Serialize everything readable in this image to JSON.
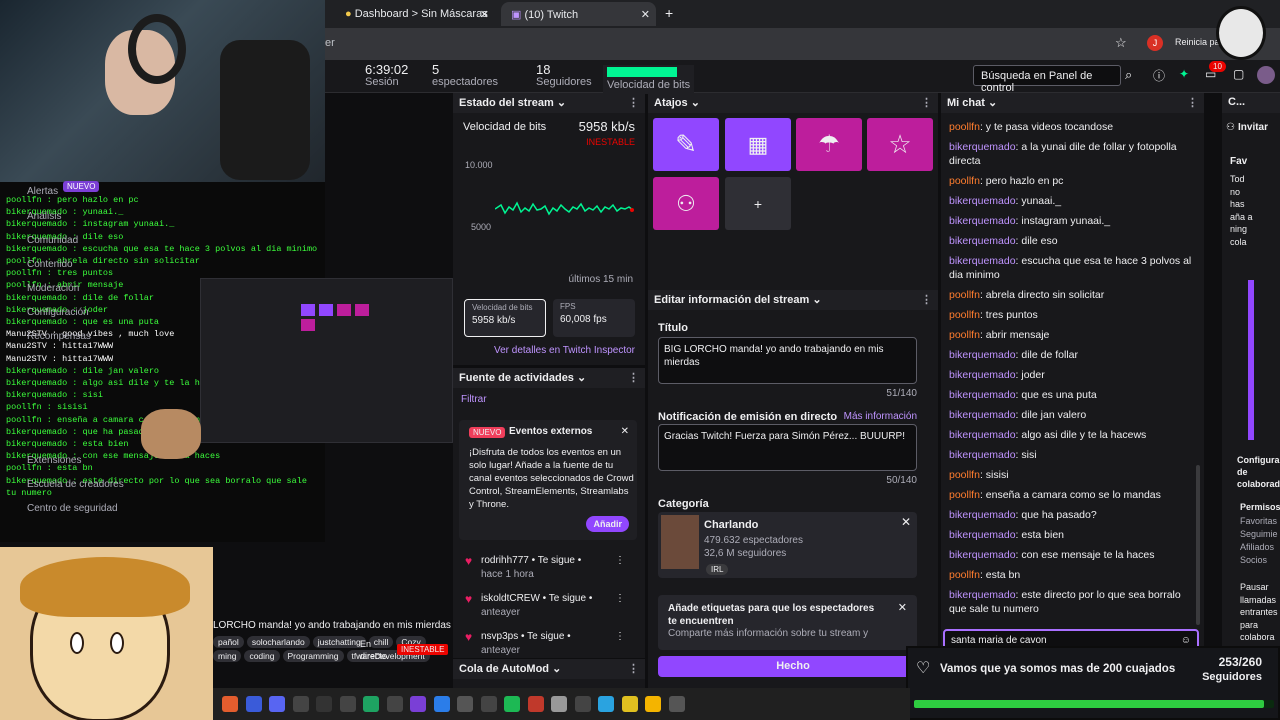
{
  "browser": {
    "tabs": [
      {
        "label": "Dashboard > Sin Máscaras"
      },
      {
        "label": "(10) Twitch"
      }
    ],
    "address_fragment": "er",
    "avatar_letter": "J",
    "restart_label": "Reinicia pa"
  },
  "topbar": {
    "uptime_value": "6:39:02",
    "uptime_label": "Sesión",
    "viewers_value": "5",
    "viewers_label": "espectadores",
    "followers_value": "18",
    "followers_label": "Seguidores",
    "bitrate_label": "Velocidad de bits",
    "search_label": "Búsqueda en Panel de control",
    "notif_count": "10"
  },
  "stream_state": {
    "title": "Estado del stream",
    "bitrate_label": "Velocidad de bits",
    "bitrate_value": "5958 kb/s",
    "status": "INESTABLE",
    "y_top": "10.000",
    "y_mid": "5000",
    "range_label": "últimos 15 min",
    "card1_label": "Velocidad de bits",
    "card1_value": "5958 kb/s",
    "card2_label": "FPS",
    "card2_value": "60,008 fps",
    "inspector_link": "Ver detalles en Twitch Inspector"
  },
  "activity": {
    "title": "Fuente de actividades",
    "filter": "Filtrar",
    "badge": "NUEVO",
    "ext_title": "Eventos externos",
    "ext_body": "¡Disfruta de todos los eventos en un solo lugar! Añade a la fuente de tu canal eventos seleccionados de Crowd Control, StreamElements, Streamlabs y Throne.",
    "add_button": "Añadir",
    "events": [
      {
        "user": "rodrihh777",
        "action": "Te sigue",
        "time": "hace 1 hora"
      },
      {
        "user": "iskoldtCREW",
        "action": "Te sigue",
        "time": "anteayer"
      },
      {
        "user": "nsvp3ps",
        "action": "Te sigue",
        "time": "anteayer"
      }
    ],
    "automod": "Cola de AutoMod"
  },
  "shortcuts": {
    "title": "Atajos",
    "add": "+"
  },
  "edit_info": {
    "title": "Editar información del stream",
    "title_label": "Título",
    "title_value": "BIG LORCHO manda! yo ando trabajando en mis mierdas",
    "title_count": "51/140",
    "notif_label": "Notificación de emisión en directo",
    "more_info": "Más información",
    "notif_value": "Gracias Twitch! Fuerza para Simón Pérez... BUUURP!",
    "notif_count": "50/140",
    "category_label": "Categoría",
    "category_name": "Charlando",
    "category_viewers": "479.632 espectadores",
    "category_followers": "32,6 M seguidores",
    "category_tag": "IRL",
    "tags_title": "Añade etiquetas para que los espectadores te encuentren",
    "tags_body": "Comparte más información sobre tu stream y",
    "done": "Hecho"
  },
  "chat": {
    "title": "Mi chat",
    "messages": [
      {
        "user": "poollfn",
        "text": ": y te pasa videos tocandose"
      },
      {
        "user": "bikerquemado",
        "text": ": a la yunai dile de follar y fotopolla directa"
      },
      {
        "user": "poollfn",
        "text": ": pero hazlo en pc"
      },
      {
        "user": "bikerquemado",
        "text": ": yunaai._"
      },
      {
        "user": "bikerquemado",
        "text": ": instagram yunaai._"
      },
      {
        "user": "bikerquemado",
        "text": ": dile eso"
      },
      {
        "user": "bikerquemado",
        "text": ": escucha que esa te hace 3 polvos al dia minimo"
      },
      {
        "user": "poollfn",
        "text": ": abrela directo sin solicitar"
      },
      {
        "user": "poollfn",
        "text": ": tres puntos"
      },
      {
        "user": "poollfn",
        "text": ": abrir mensaje"
      },
      {
        "user": "bikerquemado",
        "text": ": dile de follar"
      },
      {
        "user": "bikerquemado",
        "text": ": joder"
      },
      {
        "user": "bikerquemado",
        "text": ": que es una puta"
      },
      {
        "user": "bikerquemado",
        "text": ": dile jan valero"
      },
      {
        "user": "bikerquemado",
        "text": ": algo asi dile y te la hacews"
      },
      {
        "user": "bikerquemado",
        "text": ": sisi"
      },
      {
        "user": "poollfn",
        "text": ": sisisi"
      },
      {
        "user": "poollfn",
        "text": ": enseña a camara como se lo mandas"
      },
      {
        "user": "bikerquemado",
        "text": ": que ha pasado?"
      },
      {
        "user": "bikerquemado",
        "text": ": esta bien"
      },
      {
        "user": "bikerquemado",
        "text": ": con ese mensaje te la haces"
      },
      {
        "user": "poollfn",
        "text": ": esta bn"
      },
      {
        "user": "bikerquemado",
        "text": ": este directo por lo que sea borralo que sale tu numero"
      }
    ],
    "input_value": "santa maria de cavon"
  },
  "right_panel": {
    "title": "C...",
    "invite": "Invitar",
    "fav": "Fav",
    "fav_body": "Tod no has aña a ning cola",
    "config": "Configura de colaborad",
    "perms_title": "Permisos",
    "perms_body": "Favoritas Seguimie Afiliados Socios",
    "pause_body": "Pausar llamadas entrantes para colabora"
  },
  "goal": {
    "label": "Vamos que ya somos mas de 200 cuajados",
    "count": "253/260",
    "unit": "Seguidores",
    "progress": 0.973
  },
  "overlay": {
    "sidebar_items": [
      "Alertas",
      "Análisis",
      "Comunidad",
      "Contenido",
      "Moderación",
      "Configuración",
      "Recompensas",
      "Extensiones",
      "Escuela de creadores",
      "Centro de seguridad"
    ],
    "nuevo": "NUEVO",
    "terminal_lines": [
      "poollfn : pero hazlo en pc",
      "bikerquemado : yunaai._",
      "bikerquemado : instagram yunaai._",
      "bikerquemado : dile eso",
      "bikerquemado : escucha que esa te hace 3 polvos al dia minimo",
      "poollfn : abrela directo sin solicitar",
      "poollfn : tres puntos",
      "poollfn : abrir mensaje",
      "bikerquemado : dile de follar",
      "bikerquemado : joder",
      "bikerquemado : que es una puta",
      "Manu2STV : good vibes , much love",
      "Manu2STV : hitta17WWW",
      "Manu2STV : hitta17WWW",
      "bikerquemado : dile jan valero",
      "bikerquemado : algo asi dile y te la hacews",
      "bikerquemado : sisi",
      "poollfn : sisisi",
      "poollfn : enseña a camara como se lo mandas",
      "bikerquemado : que ha pasado?",
      "bikerquemado : esta bien",
      "bikerquemado : con ese mensaje te la haces",
      "poollfn : esta bn",
      "bikerquemado : este directo por lo que sea borralo que sale tu numero"
    ],
    "stream_title": "LORCHO manda! yo ando trabajando en mis mierdas",
    "tags": [
      "pañol",
      "solocharlando",
      "justchatting",
      "chill",
      "Cozy",
      "ming",
      "coding",
      "Programming",
      "tfwareDevelopment"
    ],
    "status": "INESTABLE",
    "en_directo": "En directo"
  },
  "colors": {
    "purple": "#9147ff",
    "magenta": "#bd1e9c",
    "goal_green": "#2ecc40",
    "terminal_green": "#3cff3c"
  }
}
